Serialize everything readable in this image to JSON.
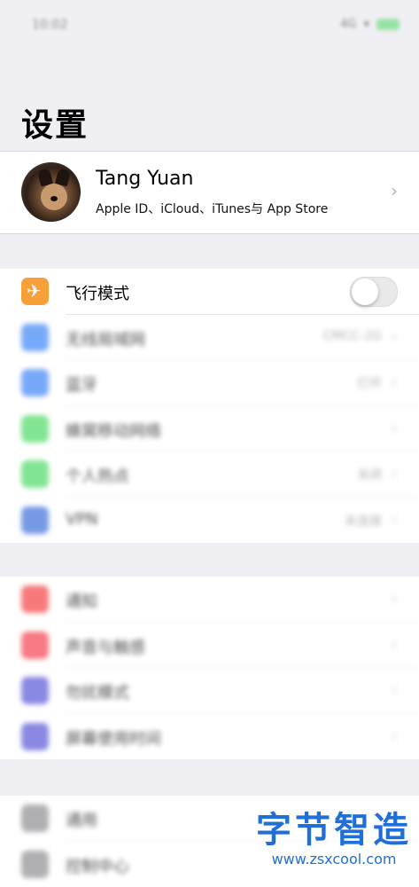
{
  "status_bar": {
    "time": "10:02",
    "signal": "4G"
  },
  "page": {
    "title": "设置"
  },
  "profile": {
    "name": "Tang Yuan",
    "subtitle": "Apple ID、iCloud、iTunes与 App Store"
  },
  "group1": [
    {
      "label": "飞行模式",
      "icon_color": "#f7a03a",
      "toggle_on": false
    },
    {
      "label": "无线局域网",
      "icon_color": "#3d85f5",
      "value": "CMCC-2G"
    },
    {
      "label": "蓝牙",
      "icon_color": "#3d85f5",
      "value": "打开"
    },
    {
      "label": "蜂窝移动网络",
      "icon_color": "#4cd964"
    },
    {
      "label": "个人热点",
      "icon_color": "#4cd964",
      "value": "关闭"
    },
    {
      "label": "VPN",
      "icon_color": "#3d6fd8",
      "value": "未连接"
    }
  ],
  "group2": [
    {
      "label": "通知",
      "icon_color": "#f54040"
    },
    {
      "label": "声音与触感",
      "icon_color": "#f54050"
    },
    {
      "label": "勿扰模式",
      "icon_color": "#5856d6"
    },
    {
      "label": "屏幕使用时间",
      "icon_color": "#5856d6"
    }
  ],
  "group3": [
    {
      "label": "通用",
      "icon_color": "#8e8e93"
    },
    {
      "label": "控制中心",
      "icon_color": "#8e8e93"
    }
  ],
  "watermark": {
    "title": "字节智造",
    "url": "www.zsxcool.com"
  },
  "colors": {
    "accent": "#1f6fd6",
    "background": "#efeff4"
  }
}
